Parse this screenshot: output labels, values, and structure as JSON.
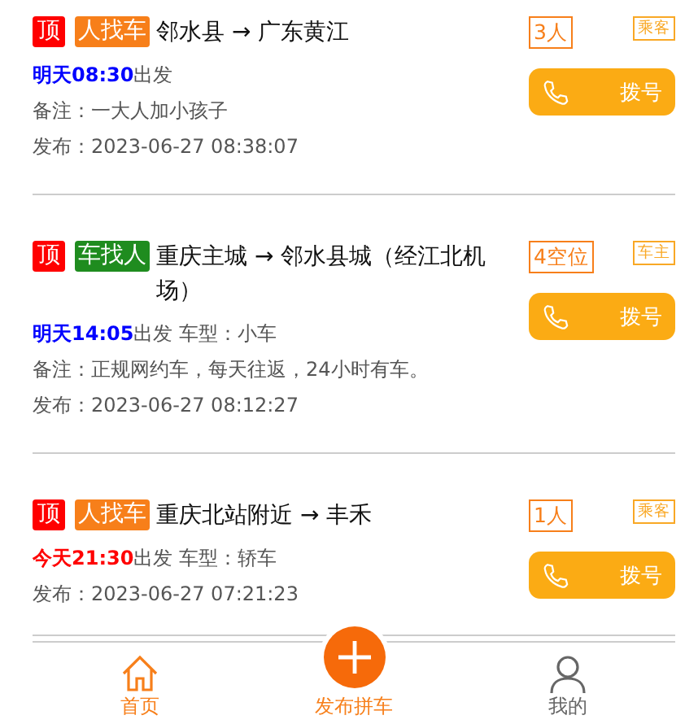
{
  "posts": [
    {
      "pinned": true,
      "pin_label": "顶",
      "kind": "passenger",
      "tag": "人找车",
      "route": "邻水县 → 广东黄江",
      "seats": "3人",
      "role": "乘客",
      "today": false,
      "when": "明天08:30",
      "depart": "出发",
      "note": "备注：一大人加小孩子",
      "published": "发布：2023-06-27 08:38:07",
      "dial": "拨号"
    },
    {
      "pinned": true,
      "pin_label": "顶",
      "kind": "driver",
      "tag": "车找人",
      "route": "重庆主城 → 邻水县城（经江北机场）",
      "seats": "4空位",
      "role": "车主",
      "today": false,
      "when": "明天14:05",
      "depart": "出发",
      "car": "车型：小车",
      "note": "备注：正规网约车，每天往返，24小时有车。",
      "published": "发布：2023-06-27 08:12:27",
      "dial": "拨号"
    },
    {
      "pinned": true,
      "pin_label": "顶",
      "kind": "passenger",
      "tag": "人找车",
      "route": "重庆北站附近 → 丰禾",
      "seats": "1人",
      "role": "乘客",
      "today": true,
      "when": "今天21:30",
      "depart": "出发",
      "car": "车型：轿车",
      "published": "发布：2023-06-27 07:21:23",
      "dial": "拨号"
    }
  ],
  "nav": [
    {
      "kind": "home",
      "label": "首页",
      "selected": true
    },
    {
      "kind": "profile",
      "label": "我的",
      "selected": false
    }
  ],
  "publish": {
    "label": "发布拼车"
  }
}
